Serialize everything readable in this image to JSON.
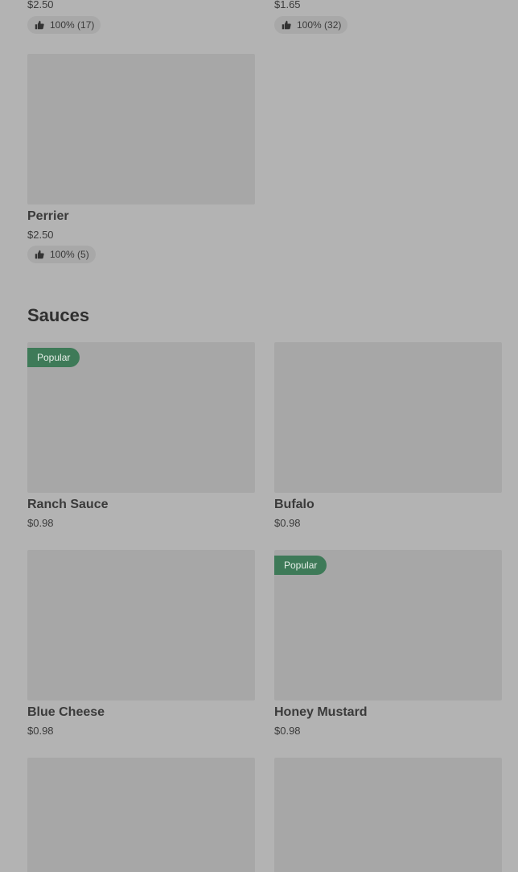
{
  "top_items": [
    {
      "price": "$2.50",
      "rating": "100% (17)"
    },
    {
      "price": "$1.65",
      "rating": "100% (32)"
    }
  ],
  "perrier": {
    "name": "Perrier",
    "price": "$2.50",
    "rating": "100% (5)"
  },
  "sauces": {
    "title": "Sauces",
    "items": [
      {
        "name": "Ranch Sauce",
        "price": "$0.98",
        "badge": "Popular"
      },
      {
        "name": "Bufalo",
        "price": "$0.98"
      },
      {
        "name": "Blue Cheese",
        "price": "$0.98"
      },
      {
        "name": "Honey Mustard",
        "price": "$0.98",
        "badge": "Popular"
      }
    ]
  },
  "colors": {
    "overlay_background": "#b3b3b3",
    "badge_green": "#3e7a58"
  },
  "icons": {
    "rating": "thumbs-up-icon"
  }
}
